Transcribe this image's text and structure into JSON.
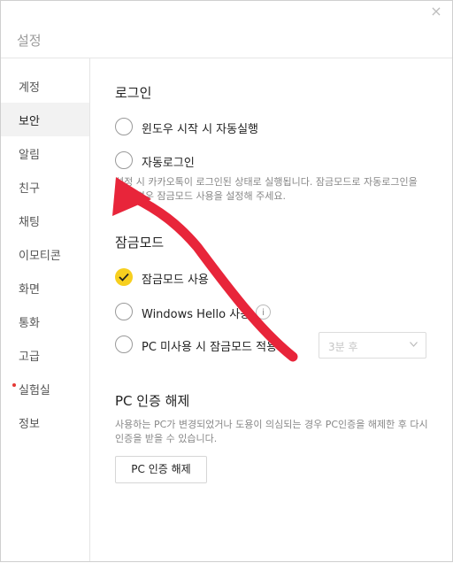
{
  "window": {
    "title": "설정",
    "close_glyph": "×"
  },
  "sidebar": {
    "items": [
      {
        "label": "계정"
      },
      {
        "label": "보안",
        "active": true
      },
      {
        "label": "알림"
      },
      {
        "label": "친구"
      },
      {
        "label": "채팅"
      },
      {
        "label": "이모티콘"
      },
      {
        "label": "화면"
      },
      {
        "label": "통화"
      },
      {
        "label": "고급"
      },
      {
        "label": "실험실",
        "badge": "red-dot"
      },
      {
        "label": "정보"
      }
    ]
  },
  "login": {
    "title": "로그인",
    "auto_start": {
      "label": "윈도우 시작 시 자동실행",
      "checked": false
    },
    "auto_login": {
      "label": "자동로그인",
      "checked": false
    },
    "description": "설정 시 카카오톡이 로그인된 상태로 실행됩니다. 잠금모드로 자동로그인을 원할 경우 잠금모드 사용을 설정해 주세요."
  },
  "lock_mode": {
    "title": "잠금모드",
    "use_lock": {
      "label": "잠금모드 사용",
      "checked": true
    },
    "windows_hello": {
      "label": "Windows Hello 사용",
      "checked": false,
      "info_icon": "i"
    },
    "pc_idle": {
      "label": "PC 미사용 시 잠금모드 적용",
      "checked": false
    },
    "idle_select": {
      "value": "3분 후"
    }
  },
  "pc_auth": {
    "title": "PC 인증 해제",
    "description": "사용하는 PC가 변경되었거나 도용이 의심되는 경우 PC인증을 해제한 후 다시 인증을 받을 수 있습니다.",
    "button_label": "PC 인증 해제"
  },
  "colors": {
    "accent": "#f7cf1f",
    "annotation_arrow": "#e8253a",
    "badge": "#e53935"
  },
  "icons": {
    "close": "close-icon",
    "check": "check-icon",
    "info": "info-icon",
    "chevron": "chevron-down-icon"
  }
}
